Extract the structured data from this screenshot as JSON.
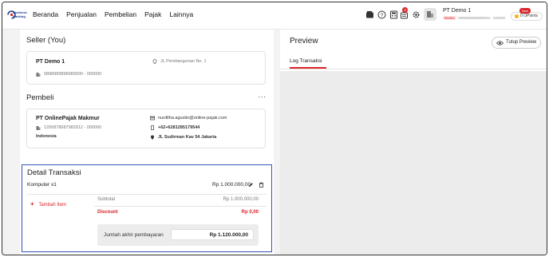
{
  "brand": {
    "logo_text": "Business Banking",
    "accent": "#d9262c",
    "highlight": "#3552b5"
  },
  "nav": {
    "items": [
      "Beranda",
      "Penjualan",
      "Pembelian",
      "Pajak",
      "Lainnya"
    ]
  },
  "header": {
    "notification_count": "4",
    "company_name": "PT Demo 1",
    "company_role": "Badan",
    "company_npwp": "0898989898989000 - 000000",
    "points_new": "New",
    "points_label": "0 OPoints"
  },
  "seller": {
    "section_title": "Seller (You)",
    "name": "PT Demo 1",
    "npwp": "0898989898989000 - 000000",
    "address": "JL Pembangunan No. 1"
  },
  "buyer": {
    "section_title": "Pembeli",
    "menu": "···",
    "name": "PT OnlinePajak Makmur",
    "npwp": "120087868798291­2 - 000000",
    "country": "Indonesia",
    "email": "nurditha.agustin@online-pajak.com",
    "phone": "+62+6281285179544",
    "address": "JL Sudirman Kav 54 Jakarta"
  },
  "detail": {
    "section_title": "Detail Transaksi",
    "item_name": "Komputer  x1",
    "item_price": "Rp 1.000.000,00",
    "add_item": "Tambah Item",
    "subtotal_label": "Subtotal",
    "subtotal_value": "Rp 1.000.000,00",
    "discount_label": "Discount",
    "discount_value": "Rp 0,00",
    "total_label": "Jumlah akhir pembayaran",
    "total_value": "Rp 1.120.000,00"
  },
  "preview": {
    "title": "Preview",
    "close_label": "Tutup Preview",
    "tab_label": "Log Transaksi"
  }
}
